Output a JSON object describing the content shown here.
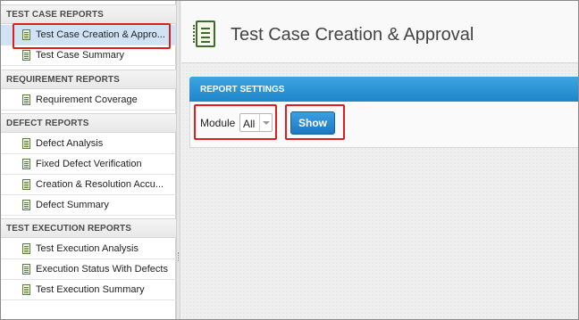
{
  "sidebar": {
    "sections": [
      {
        "title": "TEST CASE REPORTS",
        "items": [
          {
            "label": "Test Case Creation & Appro..."
          },
          {
            "label": "Test Case Summary"
          }
        ]
      },
      {
        "title": "REQUIREMENT REPORTS",
        "items": [
          {
            "label": "Requirement Coverage"
          }
        ]
      },
      {
        "title": "DEFECT REPORTS",
        "items": [
          {
            "label": "Defect Analysis"
          },
          {
            "label": "Fixed Defect Verification"
          },
          {
            "label": "Creation & Resolution Accu..."
          },
          {
            "label": "Defect Summary"
          }
        ]
      },
      {
        "title": "TEST EXECUTION REPORTS",
        "items": [
          {
            "label": "Test Execution Analysis"
          },
          {
            "label": "Execution Status With Defects"
          },
          {
            "label": "Test Execution Summary"
          }
        ]
      }
    ]
  },
  "main": {
    "title": "Test Case Creation & Approval",
    "panel_title": "REPORT SETTINGS",
    "module_label": "Module",
    "module_value": "All",
    "show_label": "Show"
  },
  "colors": {
    "accent": "#1e86c9",
    "highlight": "#e01d1d",
    "active_item": "#cfe3f5"
  }
}
